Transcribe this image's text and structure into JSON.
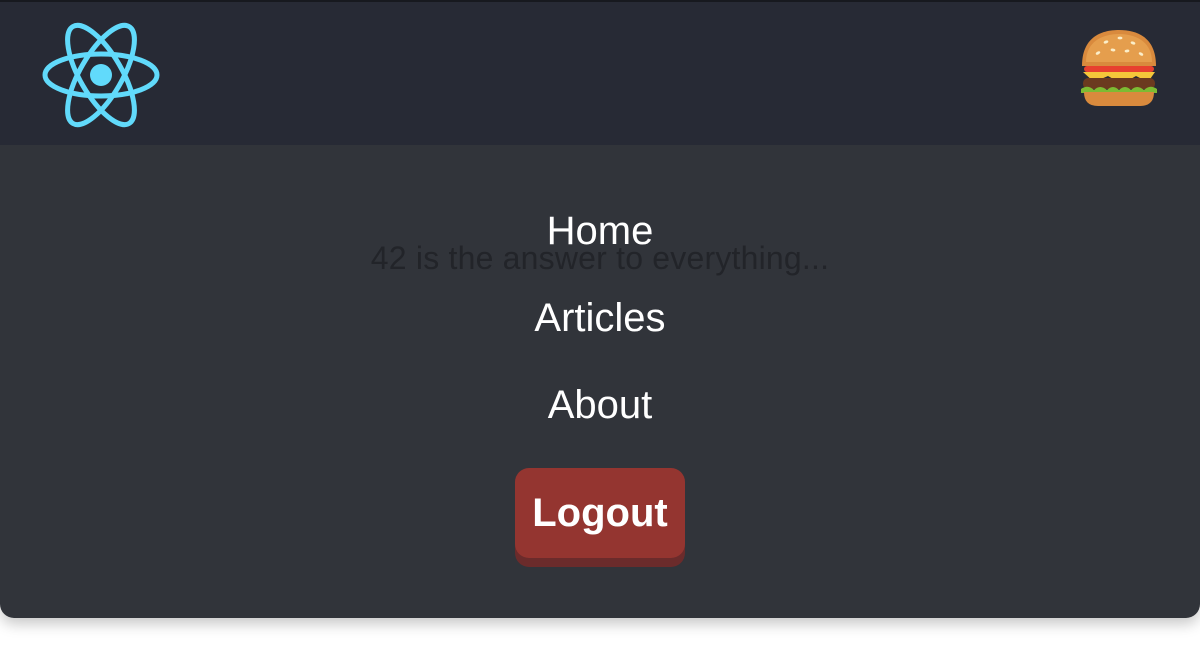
{
  "header": {
    "logo_icon": "react-atom-icon",
    "menu_icon": "hamburger-emoji-icon",
    "logo_color": "#61dafb",
    "background": "#272a35"
  },
  "page": {
    "background_text": "42 is the answer to everything...",
    "background": "#31343a"
  },
  "menu": {
    "items": [
      {
        "label": "Home"
      },
      {
        "label": "Articles"
      },
      {
        "label": "About"
      }
    ],
    "logout_label": "Logout",
    "logout_color": "#943530"
  }
}
